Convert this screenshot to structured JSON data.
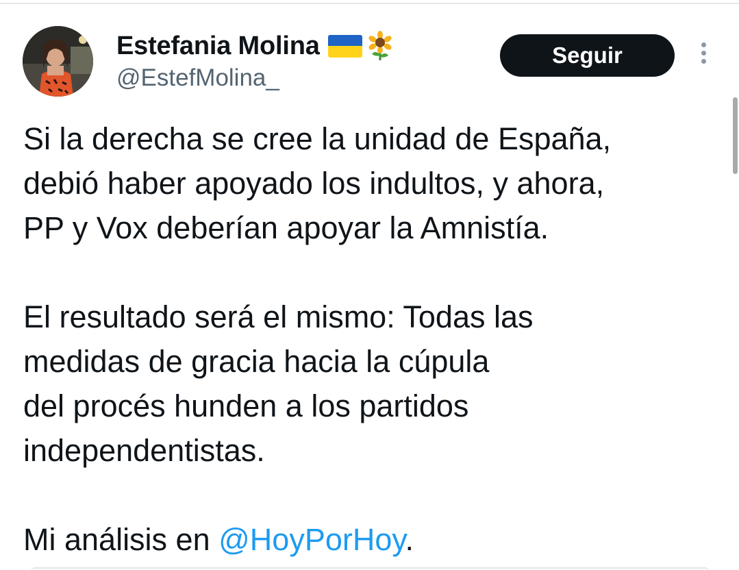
{
  "tweet": {
    "author": {
      "display_name": "Estefania Molina",
      "handle": "@EstefMolina_",
      "emojis": [
        "ukraine-flag-icon",
        "sunflower-icon"
      ]
    },
    "follow_label": "Seguir",
    "paragraph1": [
      "Si la derecha se cree la unidad de España,",
      "debió haber apoyado los indultos, y ahora,",
      "PP y Vox deberían apoyar la Amnistía."
    ],
    "paragraph2": [
      "El resultado será el mismo: Todas las",
      "medidas de gracia hacia la cúpula",
      "del procés hunden a los partidos",
      "independentistas."
    ],
    "closing": {
      "prefix": "Mi análisis en ",
      "mention": "@HoyPorHoy",
      "suffix": "."
    }
  },
  "colors": {
    "text": "#0f1419",
    "secondary_text": "#536471",
    "link": "#1d9bf0",
    "button_bg": "#0f1419",
    "button_text": "#ffffff"
  }
}
